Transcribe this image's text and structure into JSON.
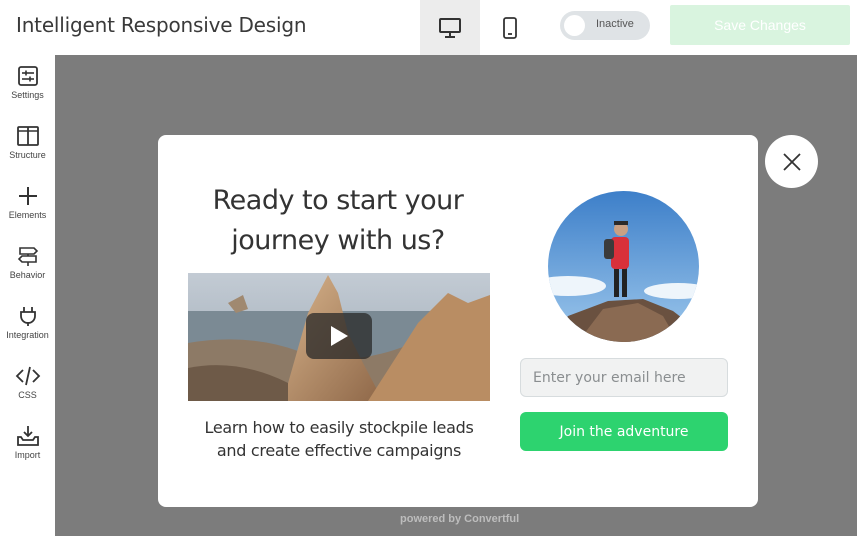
{
  "app": {
    "title": "Intelligent Responsive Design"
  },
  "toolbar": {
    "desktop_icon": "desktop-icon",
    "mobile_icon": "mobile-icon",
    "status_label": "Inactive",
    "save_label": "Save Changes"
  },
  "sidebar": {
    "items": [
      {
        "label": "Settings",
        "icon": "settings-sliders-icon"
      },
      {
        "label": "Structure",
        "icon": "columns-icon"
      },
      {
        "label": "Elements",
        "icon": "plus-icon"
      },
      {
        "label": "Behavior",
        "icon": "signpost-icon"
      },
      {
        "label": "Integration",
        "icon": "plug-icon"
      },
      {
        "label": "CSS",
        "icon": "code-icon"
      },
      {
        "label": "Import",
        "icon": "import-tray-icon"
      }
    ]
  },
  "popup": {
    "headline": "Ready to start your journey with us?",
    "description": "Learn how to easily stockpile leads and create effective campaigns",
    "email_placeholder": "Enter your email here",
    "cta_label": "Join the adventure"
  },
  "footer": {
    "powered_by": "powered by Convertful"
  },
  "colors": {
    "accent_green": "#2dd36f",
    "save_disabled": "#d9f4df",
    "canvas_gray": "#7c7c7c"
  }
}
